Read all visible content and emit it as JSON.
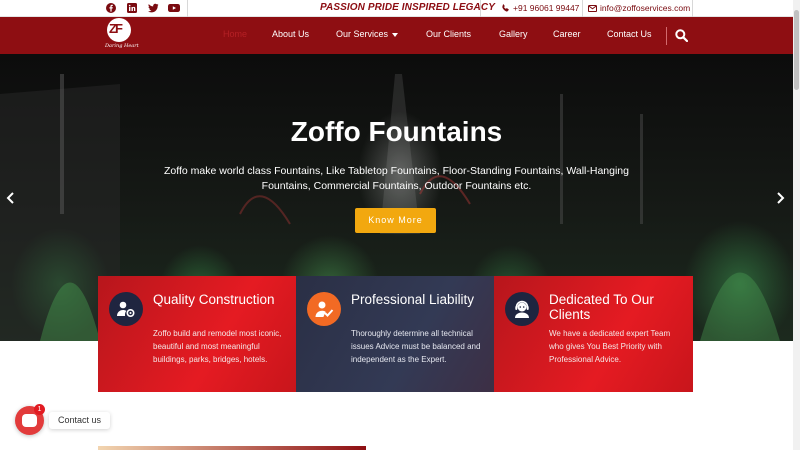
{
  "topbar": {
    "socials": [
      "facebook-icon",
      "linkedin-icon",
      "twitter-icon",
      "youtube-icon"
    ],
    "tagline": "PASSION PRIDE INSPIRED LEGACY",
    "phone": "+91 96061 99447",
    "email": "info@zoffoservices.com"
  },
  "logo": {
    "letters": "ZF",
    "tagline": "Daring Heart"
  },
  "nav": {
    "items": [
      {
        "label": "Home",
        "active": true
      },
      {
        "label": "About Us"
      },
      {
        "label": "Our Services",
        "dropdown": true
      },
      {
        "label": "Our Clients"
      },
      {
        "label": "Gallery"
      },
      {
        "label": "Career"
      },
      {
        "label": "Contact Us"
      }
    ]
  },
  "hero": {
    "title": "Zoffo Fountains",
    "text": "Zoffo make world class Fountains, Like Tabletop Fountains, Floor-Standing Fountains, Wall-Hanging Fountains, Commercial Fountains, Outdoor Fountains etc.",
    "button": "Know More"
  },
  "cards": [
    {
      "title": "Quality Construction",
      "text": "Zoffo build and remodel most iconic, beautiful and most meaningful buildings, parks, bridges, hotels.",
      "icon": "settings-user-icon"
    },
    {
      "title": "Professional Liability",
      "text": "Thoroughly determine all technical issues Advice must be balanced and independent as the Expert.",
      "icon": "user-check-icon"
    },
    {
      "title": "Dedicated To Our Clients",
      "text": "We have a dedicated expert Team who gives You Best Priority with Professional Advice.",
      "icon": "support-agent-icon"
    }
  ],
  "chat": {
    "label": "Contact us",
    "badge": "1"
  },
  "colors": {
    "brand": "#8e0e12",
    "accent": "#f2a80f",
    "card_red": "#e51b22",
    "card_navy": "#2a2f45"
  }
}
